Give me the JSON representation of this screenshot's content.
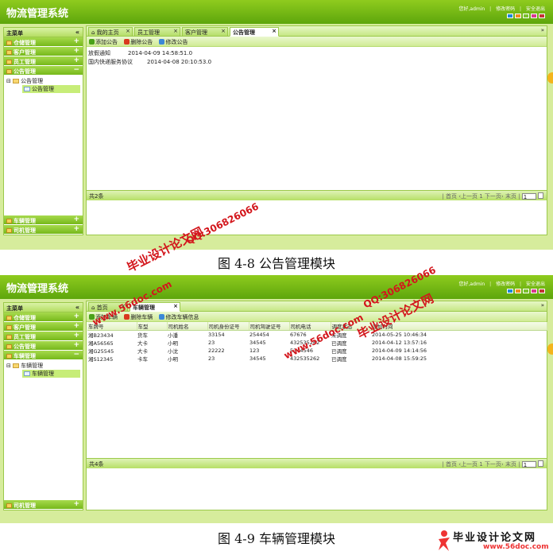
{
  "app_title": "物流管理系统",
  "top_links": [
    "您好,admin",
    "修改密码",
    "安全退出"
  ],
  "skin_colors": [
    "#1e88d8",
    "#f08c1a",
    "#7ac02c",
    "#d83a8e",
    "#c23434"
  ],
  "sidebar": {
    "header": "主菜单",
    "collapse_glyph": "«",
    "menus": [
      "仓储管理",
      "客户管理",
      "员工管理",
      "公告管理",
      "车辆管理",
      "司机管理"
    ]
  },
  "shot1": {
    "open_menu": "公告管理",
    "tree_parent": "公告管理",
    "tree_child": "公告管理",
    "bottom_menus": [
      "车辆管理",
      "司机管理"
    ],
    "tabs": [
      "我的主页",
      "员工管理",
      "客户管理",
      "公告管理"
    ],
    "toolbar": [
      "添加公告",
      "删除公告",
      "修改公告"
    ],
    "rows": [
      {
        "title": "放假通知",
        "time": "2014-04-09 14:58:51.0"
      },
      {
        "title": "国内快递服务协议",
        "time": "2014-04-08 20:10:53.0"
      }
    ],
    "pager": {
      "total": "共2条",
      "first": "首页",
      "prev": "上一页",
      "next": "下一页",
      "last": "末页",
      "page": "1"
    }
  },
  "shot2": {
    "open_menu": "车辆管理",
    "tree_parent": "车辆管理",
    "tree_child": "车辆管理",
    "bottom_menus": [
      "司机管理"
    ],
    "tabs": [
      "首页",
      "车辆管理"
    ],
    "toolbar": [
      "添加车辆",
      "删除车辆",
      "修改车辆信息"
    ],
    "columns": [
      "车牌号",
      "车型",
      "司机姓名",
      "司机身份证号",
      "司机驾驶证号",
      "司机电话",
      "调度状态",
      "添加时间"
    ],
    "rows": [
      [
        "湘B23434",
        "货车",
        "小潘",
        "33154",
        "254454",
        "67676",
        "未调度",
        "2014-05-25 10:46:34"
      ],
      [
        "湘A56565",
        "大卡",
        "小明",
        "23",
        "34545",
        "432535262",
        "已调度",
        "2014-04-12 13:57:16"
      ],
      [
        "湘G25545",
        "大卡",
        "小沈",
        "22222",
        "123",
        "5344546",
        "已调度",
        "2014-04-09 14:14:56"
      ],
      [
        "湘S12345",
        "卡车",
        "小明",
        "23",
        "34545",
        "432535262",
        "已调度",
        "2014-04-08 15:59:25"
      ]
    ],
    "pager": {
      "total": "共4条",
      "first": "首页",
      "prev": "上一页",
      "next": "下一页",
      "last": "末页",
      "page": "1"
    }
  },
  "captions": [
    "图 4-8 公告管理模块",
    "图 4-9 车辆管理模块"
  ],
  "watermarks": {
    "site1": "毕业设计论文网",
    "url1": "www.56doc.com",
    "qq1": "QQ:306826066",
    "qq2": "QQ:306826066",
    "url2": "www.56doc.com",
    "site2": "毕业设计论文网"
  },
  "logo": {
    "cn": "毕业设计论文网",
    "url": "www.56doc.com"
  }
}
